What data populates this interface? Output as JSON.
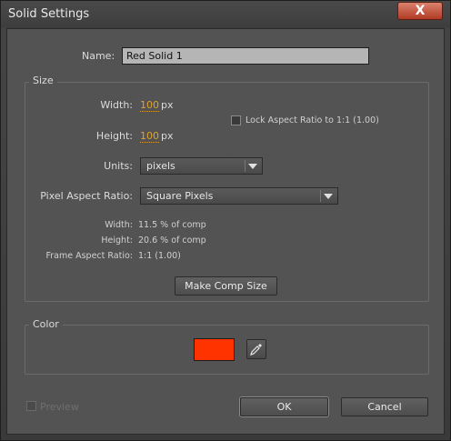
{
  "window": {
    "title": "Solid Settings",
    "close_label": "X"
  },
  "name": {
    "label": "Name:",
    "value": "Red Solid 1"
  },
  "size": {
    "group_label": "Size",
    "width_label": "Width:",
    "width_value": "100",
    "width_unit": "px",
    "height_label": "Height:",
    "height_value": "100",
    "height_unit": "px",
    "lock_aspect_label": "Lock Aspect Ratio to 1:1 (1.00)",
    "units_label": "Units:",
    "units_value": "pixels",
    "pixel_aspect_label": "Pixel Aspect Ratio:",
    "pixel_aspect_value": "Square Pixels",
    "info": {
      "width_label": "Width:",
      "width_value": "11.5 % of comp",
      "height_label": "Height:",
      "height_value": "20.6 % of comp",
      "frame_aspect_label": "Frame Aspect Ratio:",
      "frame_aspect_value": "1:1 (1.00)"
    },
    "make_comp_size_label": "Make Comp Size"
  },
  "color": {
    "group_label": "Color",
    "swatch": "#ff3300"
  },
  "footer": {
    "preview_label": "Preview",
    "ok_label": "OK",
    "cancel_label": "Cancel"
  }
}
